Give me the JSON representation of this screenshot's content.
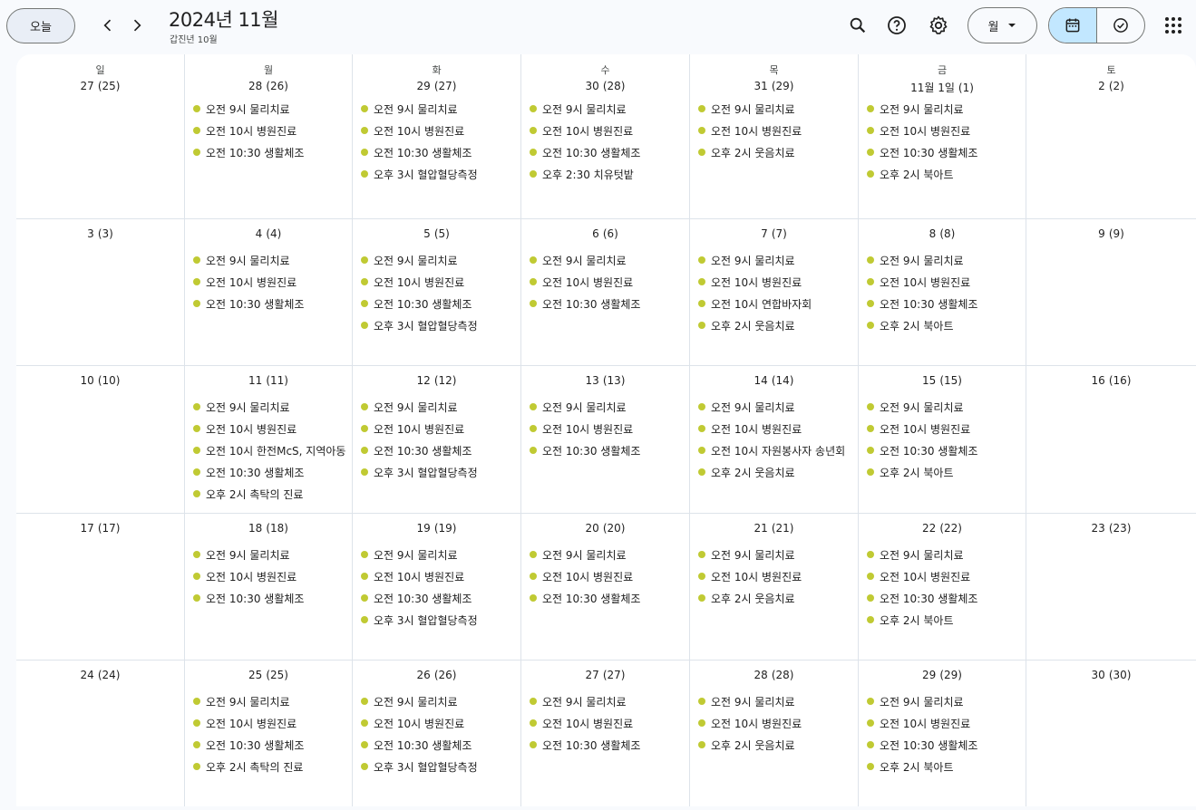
{
  "header": {
    "today_label": "오늘",
    "title": "2024년 11월",
    "subtitle": "갑진년 10월",
    "view_label": "월",
    "icons": {
      "search": "search-icon",
      "help": "help-icon",
      "settings": "gear-icon",
      "calendar": "calendar-icon",
      "tasks": "task-check-icon",
      "apps": "apps-grid-icon"
    }
  },
  "event_color": "#c0ca33",
  "weekdays": [
    "일",
    "월",
    "화",
    "수",
    "목",
    "금",
    "토"
  ],
  "weeks": [
    [
      {
        "day": "27",
        "lunar": "(25)",
        "events": []
      },
      {
        "day": "28",
        "lunar": "(26)",
        "events": [
          "오전 9시 물리치료",
          "오전 10시 병원진료",
          "오전 10:30 생활체조"
        ]
      },
      {
        "day": "29",
        "lunar": "(27)",
        "events": [
          "오전 9시 물리치료",
          "오전 10시 병원진료",
          "오전 10:30 생활체조",
          "오후 3시 혈압혈당측정"
        ]
      },
      {
        "day": "30",
        "lunar": "(28)",
        "events": [
          "오전 9시 물리치료",
          "오전 10시 병원진료",
          "오전 10:30 생활체조",
          "오후 2:30 치유텃밭"
        ]
      },
      {
        "day": "31",
        "lunar": "(29)",
        "events": [
          "오전 9시 물리치료",
          "오전 10시 병원진료",
          "오후 2시 웃음치료"
        ]
      },
      {
        "day": "11월 1일",
        "lunar": "(1)",
        "events": [
          "오전 9시 물리치료",
          "오전 10시 병원진료",
          "오전 10:30 생활체조",
          "오후 2시 북아트"
        ]
      },
      {
        "day": "2",
        "lunar": "(2)",
        "events": []
      }
    ],
    [
      {
        "day": "3",
        "lunar": "(3)",
        "events": []
      },
      {
        "day": "4",
        "lunar": "(4)",
        "events": [
          "오전 9시 물리치료",
          "오전 10시 병원진료",
          "오전 10:30 생활체조"
        ]
      },
      {
        "day": "5",
        "lunar": "(5)",
        "events": [
          "오전 9시 물리치료",
          "오전 10시 병원진료",
          "오전 10:30 생활체조",
          "오후 3시 혈압혈당측정"
        ]
      },
      {
        "day": "6",
        "lunar": "(6)",
        "events": [
          "오전 9시 물리치료",
          "오전 10시 병원진료",
          "오전 10:30 생활체조"
        ]
      },
      {
        "day": "7",
        "lunar": "(7)",
        "events": [
          "오전 9시 물리치료",
          "오전 10시 병원진료",
          "오전 10시 연합바자회",
          "오후 2시 웃음치료"
        ]
      },
      {
        "day": "8",
        "lunar": "(8)",
        "events": [
          "오전 9시 물리치료",
          "오전 10시 병원진료",
          "오전 10:30 생활체조",
          "오후 2시 북아트"
        ]
      },
      {
        "day": "9",
        "lunar": "(9)",
        "events": []
      }
    ],
    [
      {
        "day": "10",
        "lunar": "(10)",
        "events": []
      },
      {
        "day": "11",
        "lunar": "(11)",
        "events": [
          "오전 9시 물리치료",
          "오전 10시 병원진료",
          "오전 10시 한전McS, 지역아동",
          "오전 10:30 생활체조",
          "오후 2시 촉탁의 진료"
        ]
      },
      {
        "day": "12",
        "lunar": "(12)",
        "events": [
          "오전 9시 물리치료",
          "오전 10시 병원진료",
          "오전 10:30 생활체조",
          "오후 3시 혈압혈당측정"
        ]
      },
      {
        "day": "13",
        "lunar": "(13)",
        "events": [
          "오전 9시 물리치료",
          "오전 10시 병원진료",
          "오전 10:30 생활체조"
        ]
      },
      {
        "day": "14",
        "lunar": "(14)",
        "events": [
          "오전 9시 물리치료",
          "오전 10시 병원진료",
          "오전 10시 자원봉사자 송년회",
          "오후 2시 웃음치료"
        ]
      },
      {
        "day": "15",
        "lunar": "(15)",
        "events": [
          "오전 9시 물리치료",
          "오전 10시 병원진료",
          "오전 10:30 생활체조",
          "오후 2시 북아트"
        ]
      },
      {
        "day": "16",
        "lunar": "(16)",
        "events": []
      }
    ],
    [
      {
        "day": "17",
        "lunar": "(17)",
        "events": []
      },
      {
        "day": "18",
        "lunar": "(18)",
        "events": [
          "오전 9시 물리치료",
          "오전 10시 병원진료",
          "오전 10:30 생활체조"
        ]
      },
      {
        "day": "19",
        "lunar": "(19)",
        "events": [
          "오전 9시 물리치료",
          "오전 10시 병원진료",
          "오전 10:30 생활체조",
          "오후 3시 혈압혈당측정"
        ]
      },
      {
        "day": "20",
        "lunar": "(20)",
        "events": [
          "오전 9시 물리치료",
          "오전 10시 병원진료",
          "오전 10:30 생활체조"
        ]
      },
      {
        "day": "21",
        "lunar": "(21)",
        "events": [
          "오전 9시 물리치료",
          "오전 10시 병원진료",
          "오후 2시 웃음치료"
        ]
      },
      {
        "day": "22",
        "lunar": "(22)",
        "events": [
          "오전 9시 물리치료",
          "오전 10시 병원진료",
          "오전 10:30 생활체조",
          "오후 2시 북아트"
        ]
      },
      {
        "day": "23",
        "lunar": "(23)",
        "events": []
      }
    ],
    [
      {
        "day": "24",
        "lunar": "(24)",
        "events": []
      },
      {
        "day": "25",
        "lunar": "(25)",
        "events": [
          "오전 9시 물리치료",
          "오전 10시 병원진료",
          "오전 10:30 생활체조",
          "오후 2시 촉탁의 진료"
        ]
      },
      {
        "day": "26",
        "lunar": "(26)",
        "events": [
          "오전 9시 물리치료",
          "오전 10시 병원진료",
          "오전 10:30 생활체조",
          "오후 3시 혈압혈당측정"
        ]
      },
      {
        "day": "27",
        "lunar": "(27)",
        "events": [
          "오전 9시 물리치료",
          "오전 10시 병원진료",
          "오전 10:30 생활체조"
        ]
      },
      {
        "day": "28",
        "lunar": "(28)",
        "events": [
          "오전 9시 물리치료",
          "오전 10시 병원진료",
          "오후 2시 웃음치료"
        ]
      },
      {
        "day": "29",
        "lunar": "(29)",
        "events": [
          "오전 9시 물리치료",
          "오전 10시 병원진료",
          "오전 10:30 생활체조",
          "오후 2시 북아트"
        ]
      },
      {
        "day": "30",
        "lunar": "(30)",
        "events": []
      }
    ]
  ]
}
